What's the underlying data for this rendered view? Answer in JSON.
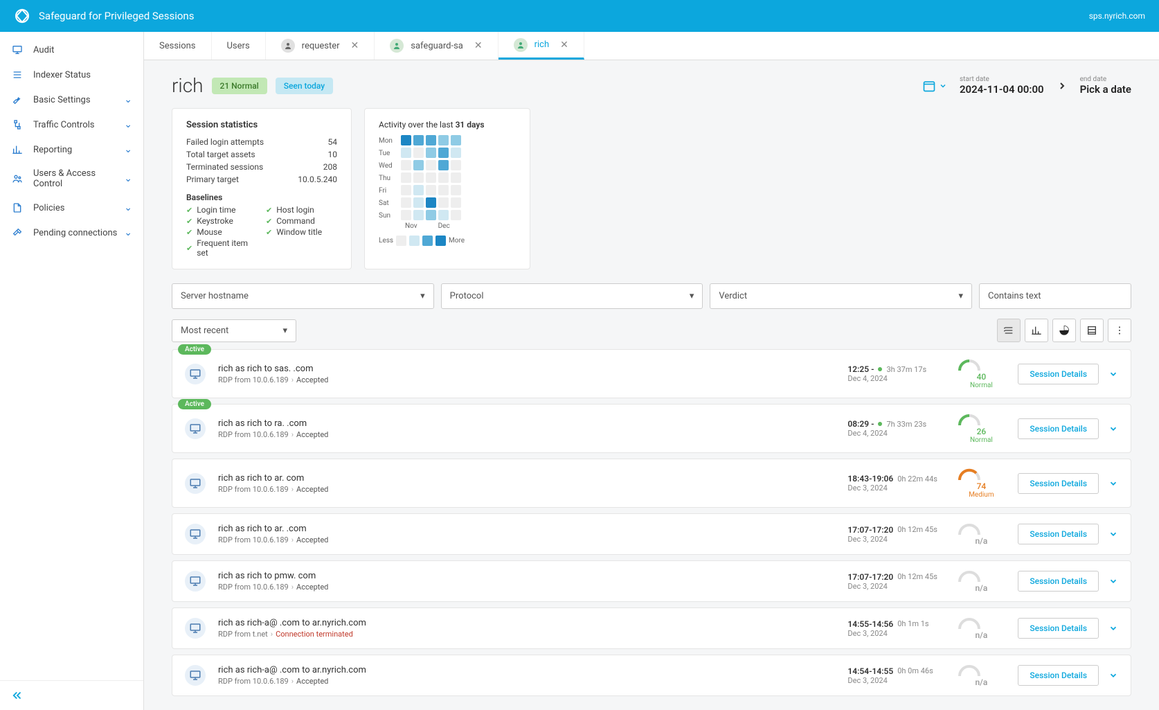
{
  "topbar": {
    "title": "Safeguard for Privileged Sessions",
    "host": "sps.nyrich.com"
  },
  "sidebar": {
    "items": [
      {
        "label": "Audit",
        "icon": "monitor",
        "expandable": false
      },
      {
        "label": "Indexer Status",
        "icon": "list",
        "expandable": false
      },
      {
        "label": "Basic Settings",
        "icon": "wrench",
        "expandable": true
      },
      {
        "label": "Traffic Controls",
        "icon": "traffic",
        "expandable": true
      },
      {
        "label": "Reporting",
        "icon": "chart",
        "expandable": true
      },
      {
        "label": "Users & Access Control",
        "icon": "users",
        "expandable": true
      },
      {
        "label": "Policies",
        "icon": "doc",
        "expandable": true
      },
      {
        "label": "Pending connections",
        "icon": "hammer",
        "expandable": true
      }
    ]
  },
  "tabs": [
    {
      "label": "Sessions",
      "kind": "plain",
      "close": false
    },
    {
      "label": "Users",
      "kind": "plain",
      "close": false
    },
    {
      "label": "requester",
      "kind": "user-gray",
      "close": true
    },
    {
      "label": "safeguard-sa",
      "kind": "user-green",
      "close": true
    },
    {
      "label": "rich",
      "kind": "user-green",
      "close": true,
      "active": true
    }
  ],
  "header": {
    "username": "rich",
    "normal_pill": "21 Normal",
    "seen_pill": "Seen today",
    "start_label": "start date",
    "start_value": "2024-11-04 00:00",
    "end_label": "end date",
    "end_value": "Pick a date"
  },
  "stats": {
    "title": "Session statistics",
    "rows": [
      {
        "k": "Failed login attempts",
        "v": "54"
      },
      {
        "k": "Total target assets",
        "v": "10"
      },
      {
        "k": "Terminated sessions",
        "v": "208"
      },
      {
        "k": "Primary target",
        "v": "10.0.5.240"
      }
    ],
    "baselines_title": "Baselines",
    "baselines": [
      "Login time",
      "Host login",
      "Keystroke",
      "Command",
      "Mouse",
      "Window title",
      "Frequent item set"
    ]
  },
  "activity": {
    "title_prefix": "Activity over the last ",
    "title_days": "31 days",
    "days": [
      "Mon",
      "Tue",
      "Wed",
      "Thu",
      "Fri",
      "Sat",
      "Sun"
    ],
    "months": [
      "Nov",
      "Dec"
    ],
    "less": "Less",
    "more": "More"
  },
  "filters": {
    "hostname": "Server hostname",
    "protocol": "Protocol",
    "verdict": "Verdict",
    "contains": "Contains text",
    "sort": "Most recent"
  },
  "sessions": [
    {
      "active": true,
      "title": "rich as rich to sas.          .com",
      "sub_from": "RDP from 10.0.6.189",
      "sub_status": "Accepted",
      "status_class": "accepted",
      "time": "12:25 -",
      "dot": true,
      "duration": "3h 37m 17s",
      "date": "Dec 4, 2024",
      "score": "40",
      "score_label": "Normal",
      "score_class": "normal"
    },
    {
      "active": true,
      "title": "rich as rich to ra.         .com",
      "sub_from": "RDP from 10.0.6.189",
      "sub_status": "Accepted",
      "status_class": "accepted",
      "time": "08:29 -",
      "dot": true,
      "duration": "7h 33m 23s",
      "date": "Dec 4, 2024",
      "score": "26",
      "score_label": "Normal",
      "score_class": "normal"
    },
    {
      "active": false,
      "title": "rich as rich to ar.          com",
      "sub_from": "RDP from 10.0.6.189",
      "sub_status": "Accepted",
      "status_class": "accepted",
      "time": "18:43-19:06",
      "dot": false,
      "duration": "0h 22m 44s",
      "date": "Dec 3, 2024",
      "score": "74",
      "score_label": "Medium",
      "score_class": "medium"
    },
    {
      "active": false,
      "title": "rich as rich to ar.          .com",
      "sub_from": "RDP from 10.0.6.189",
      "sub_status": "Accepted",
      "status_class": "accepted",
      "time": "17:07-17:20",
      "dot": false,
      "duration": "0h 12m 45s",
      "date": "Dec 3, 2024",
      "score": "n/a",
      "score_label": "",
      "score_class": "na"
    },
    {
      "active": false,
      "title": "rich as rich to pmw.           com",
      "sub_from": "RDP from 10.0.6.189",
      "sub_status": "Accepted",
      "status_class": "accepted",
      "time": "17:07-17:20",
      "dot": false,
      "duration": "0h 12m 45s",
      "date": "Dec 3, 2024",
      "score": "n/a",
      "score_label": "",
      "score_class": "na"
    },
    {
      "active": false,
      "title": "rich as rich-a@        .com to ar.nyrich.com",
      "sub_from": "RDP from                 t.net",
      "sub_status": "Connection terminated",
      "status_class": "terminated",
      "time": "14:55-14:56",
      "dot": false,
      "duration": "0h 1m 1s",
      "date": "Dec 3, 2024",
      "score": "n/a",
      "score_label": "",
      "score_class": "na"
    },
    {
      "active": false,
      "title": "rich as rich-a@        .com to ar.nyrich.com",
      "sub_from": "RDP from 10.0.6.189",
      "sub_status": "Accepted",
      "status_class": "accepted",
      "time": "14:54-14:55",
      "dot": false,
      "duration": "0h 0m 46s",
      "date": "Dec 3, 2024",
      "score": "n/a",
      "score_label": "",
      "score_class": "na"
    }
  ],
  "btn_details": "Session Details",
  "badge_active": "Active"
}
